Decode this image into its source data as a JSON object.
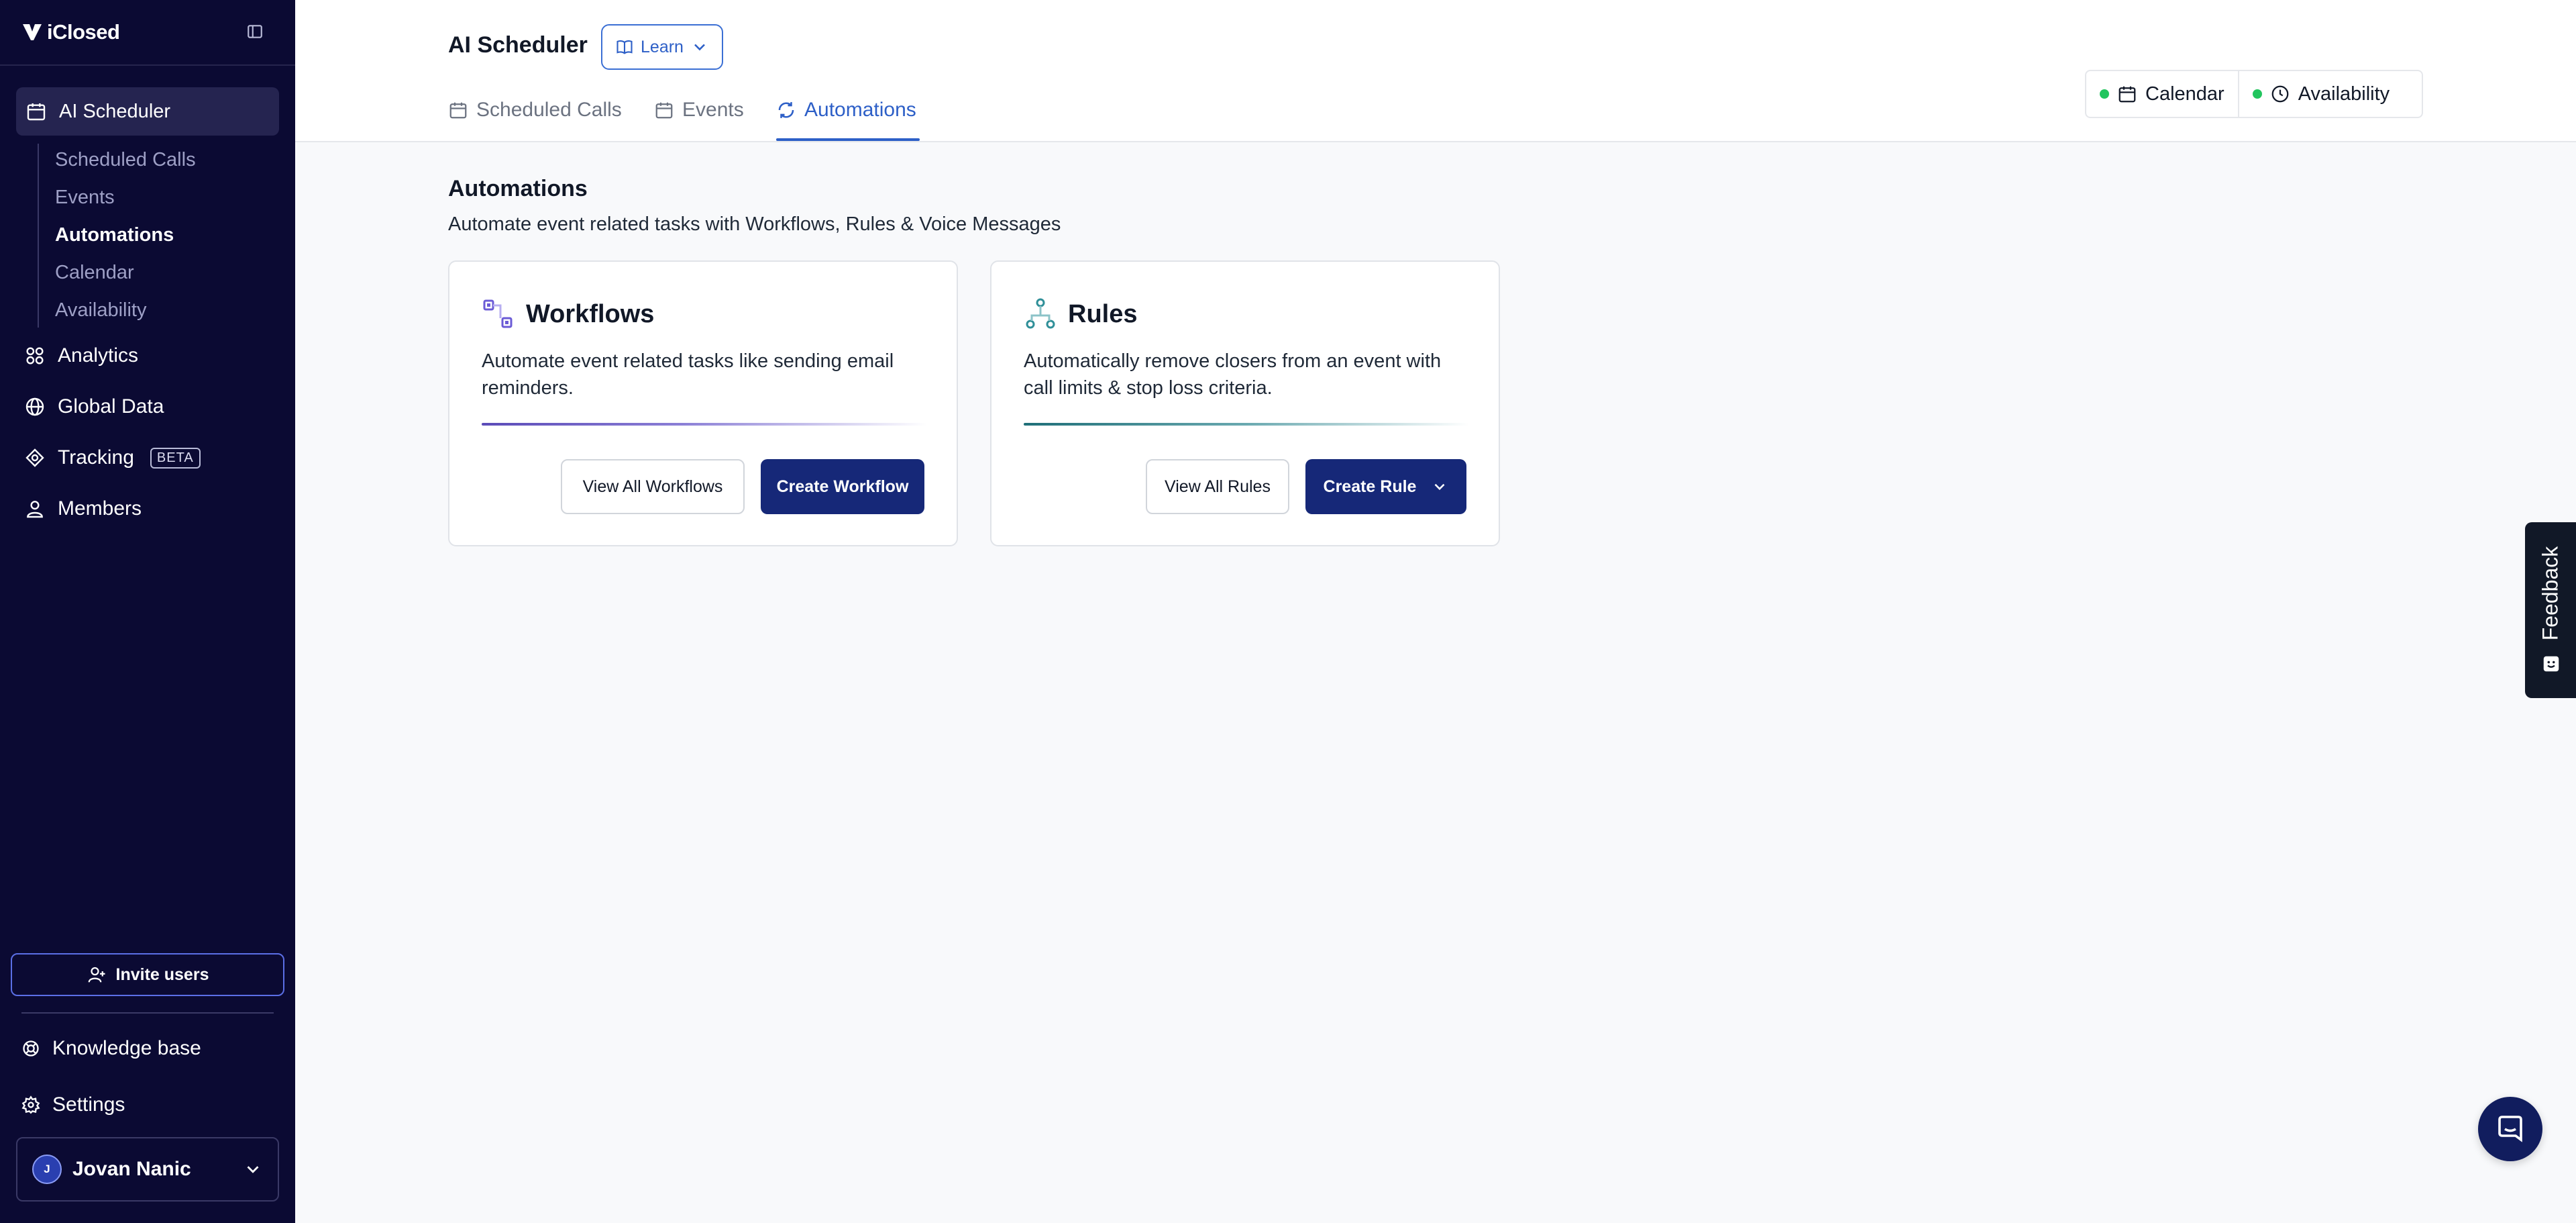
{
  "sidebar": {
    "brand": "iClosed",
    "active_section": "AI Scheduler",
    "sub_items": [
      {
        "label": "Scheduled Calls",
        "active": false
      },
      {
        "label": "Events",
        "active": false
      },
      {
        "label": "Automations",
        "active": true
      },
      {
        "label": "Calendar",
        "active": false
      },
      {
        "label": "Availability",
        "active": false
      }
    ],
    "nav_items": [
      {
        "label": "Analytics",
        "icon": "grid-icon"
      },
      {
        "label": "Global Data",
        "icon": "globe-icon"
      },
      {
        "label": "Tracking",
        "icon": "target-icon",
        "badge": "BETA"
      },
      {
        "label": "Members",
        "icon": "users-icon"
      }
    ],
    "invite_label": "Invite users",
    "footer_items": [
      {
        "label": "Knowledge base",
        "icon": "lifebuoy-icon"
      },
      {
        "label": "Settings",
        "icon": "gear-icon"
      }
    ],
    "user": {
      "initial": "J",
      "name": "Jovan Nanic"
    }
  },
  "header": {
    "title": "AI Scheduler",
    "learn_label": "Learn",
    "tabs": [
      {
        "label": "Scheduled Calls",
        "active": false
      },
      {
        "label": "Events",
        "active": false
      },
      {
        "label": "Automations",
        "active": true
      }
    ],
    "status": [
      {
        "label": "Calendar",
        "state_color": "#22c55e"
      },
      {
        "label": "Availability",
        "state_color": "#22c55e"
      }
    ]
  },
  "main": {
    "title": "Automations",
    "subtitle": "Automate event related tasks with Workflows, Rules & Voice Messages",
    "cards": [
      {
        "title": "Workflows",
        "description": "Automate event related tasks like sending email reminders.",
        "secondary_label": "View All Workflows",
        "primary_label": "Create Workflow"
      },
      {
        "title": "Rules",
        "description": "Automatically remove closers from an event with call limits & stop loss criteria.",
        "secondary_label": "View All Rules",
        "primary_label": "Create Rule"
      }
    ]
  },
  "feedback_label": "Feedback",
  "colors": {
    "sidebar_bg": "#0b0a33",
    "accent": "#2d5fc7",
    "primary_button": "#162878",
    "status_ok": "#22c55e"
  }
}
